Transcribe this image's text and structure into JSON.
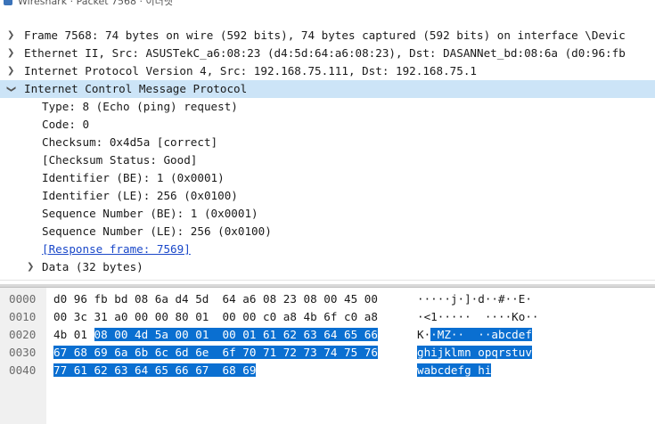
{
  "window": {
    "title": "Wireshark · Packet 7568 · 이더넷"
  },
  "tree": {
    "frame": "Frame 7568: 74 bytes on wire (592 bits), 74 bytes captured (592 bits) on interface \\Devic",
    "ethernet": "Ethernet II, Src: ASUSTekC_a6:08:23 (d4:5d:64:a6:08:23), Dst: DASANNet_bd:08:6a (d0:96:fb",
    "ip": "Internet Protocol Version 4, Src: 192.168.75.111, Dst: 192.168.75.1",
    "icmp": "Internet Control Message Protocol",
    "fields": [
      "Type: 8 (Echo (ping) request)",
      "Code: 0",
      "Checksum: 0x4d5a [correct]",
      "[Checksum Status: Good]",
      "Identifier (BE): 1 (0x0001)",
      "Identifier (LE): 256 (0x0100)",
      "Sequence Number (BE): 1 (0x0001)",
      "Sequence Number (LE): 256 (0x0100)"
    ],
    "response_frame": "[Response frame: 7569]",
    "data": "Data (32 bytes)"
  },
  "bytes": {
    "rows": [
      {
        "offset": "0000",
        "hex": "d0 96 fb bd 08 6a d4 5d  64 a6 08 23 08 00 45 00",
        "ascii": "·····j·]·d··#··E·"
      },
      {
        "offset": "0010",
        "hex": "00 3c 31 a0 00 00 80 01  00 00 c0 a8 4b 6f c0 a8",
        "ascii": "·<1·····  ····Ko··"
      },
      {
        "offset": "0020",
        "hex_plain": "4b 01 ",
        "hex_hl": "08 00 4d 5a 00 01  00 01 61 62 63 64 65 66",
        "ascii_plain": "K·",
        "ascii_hl": "·MZ··  ··abcdef"
      },
      {
        "offset": "0030",
        "hex_hl": "67 68 69 6a 6b 6c 6d 6e  6f 70 71 72 73 74 75 76",
        "ascii_hl": "ghijklmn opqrstuv"
      },
      {
        "offset": "0040",
        "hex_hl": "77 61 62 63 64 65 66 67  68 69",
        "ascii_hl": "wabcdefg hi"
      }
    ]
  },
  "colors": {
    "selected_row": "#cce4f7",
    "byte_highlight": "#0a6fd1",
    "link": "#1a48c9"
  }
}
